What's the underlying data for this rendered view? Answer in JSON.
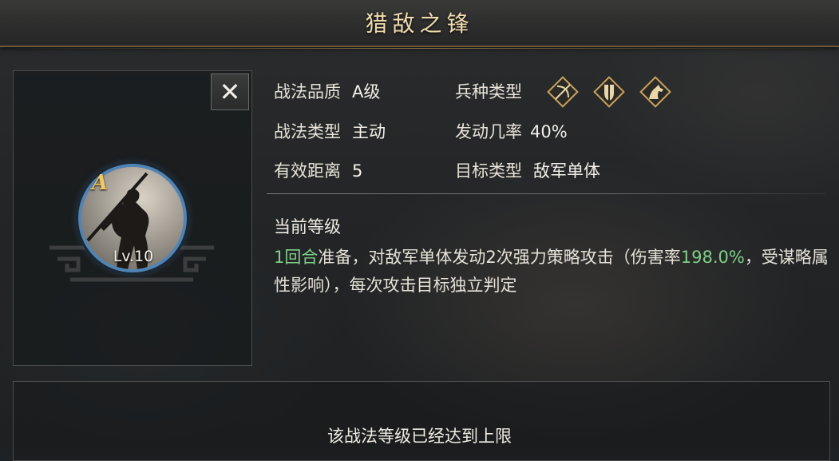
{
  "title": "猎敌之锋",
  "close_icon": "close-icon",
  "portrait": {
    "grade": "A",
    "level": "Lv.10"
  },
  "attributes": {
    "quality_label": "战法品质",
    "quality_value": "A级",
    "type_label": "战法类型",
    "type_value": "主动",
    "range_label": "有效距离",
    "range_value": "5",
    "troop_label": "兵种类型",
    "troop_icons": [
      "archer-icon",
      "shield-icon",
      "cavalry-icon"
    ],
    "rate_label": "发动几率",
    "rate_value": "40%",
    "target_label": "目标类型",
    "target_value": "敌军单体"
  },
  "current_level": {
    "label": "当前等级",
    "desc_green_1": "1回合",
    "desc_1": "准备，对敌军单体发动2次强力策略攻击（伤害率",
    "desc_green_2": "198.0%",
    "desc_2": "，受谋略属性影响），每次攻击目标独立判定"
  },
  "max_level_note": "该战法等级已经达到上限",
  "colors": {
    "title": "#f0dcb0",
    "highlight_green": "#7fcf8a",
    "ring_blue": "#4f84b5",
    "gold": "#c9a45c"
  }
}
